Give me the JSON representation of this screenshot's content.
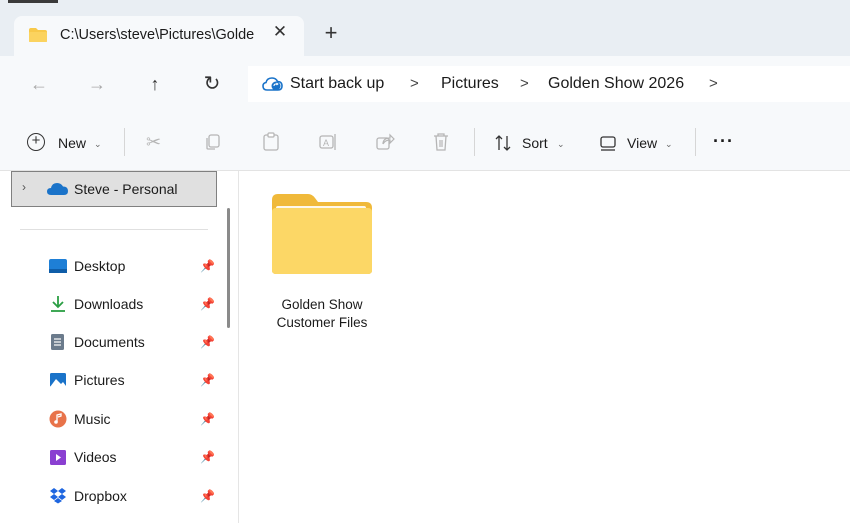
{
  "tab": {
    "title": "C:\\Users\\steve\\Pictures\\Golde",
    "close_icon": "close-icon",
    "new_tab_icon": "plus-icon"
  },
  "nav": {
    "back": "←",
    "forward": "→",
    "up": "↑",
    "refresh": "↻"
  },
  "address": {
    "crumbs": [
      "Start back up",
      "Pictures",
      "Golden Show 2026"
    ],
    "separator": ">"
  },
  "toolbar": {
    "new_label": "New",
    "sort_label": "Sort",
    "view_label": "View",
    "more_label": "···"
  },
  "sidebar": {
    "selected": "Steve - Personal",
    "items": [
      {
        "label": "Desktop",
        "icon": "desktop-icon",
        "color": "#1e7fd6"
      },
      {
        "label": "Downloads",
        "icon": "download-icon",
        "color": "#2b9e44"
      },
      {
        "label": "Documents",
        "icon": "document-icon",
        "color": "#6b7b8c"
      },
      {
        "label": "Pictures",
        "icon": "pictures-icon",
        "color": "#1a73c9"
      },
      {
        "label": "Music",
        "icon": "music-icon",
        "color": "#e8734a"
      },
      {
        "label": "Videos",
        "icon": "videos-icon",
        "color": "#8a3fd1"
      },
      {
        "label": "Dropbox",
        "icon": "dropbox-icon",
        "color": "#1e66e0"
      }
    ]
  },
  "content": {
    "folder_line1": "Golden Show",
    "folder_line2": "Customer Files"
  },
  "colors": {
    "folder": "#f8c94a",
    "accent": "#0067c0"
  }
}
